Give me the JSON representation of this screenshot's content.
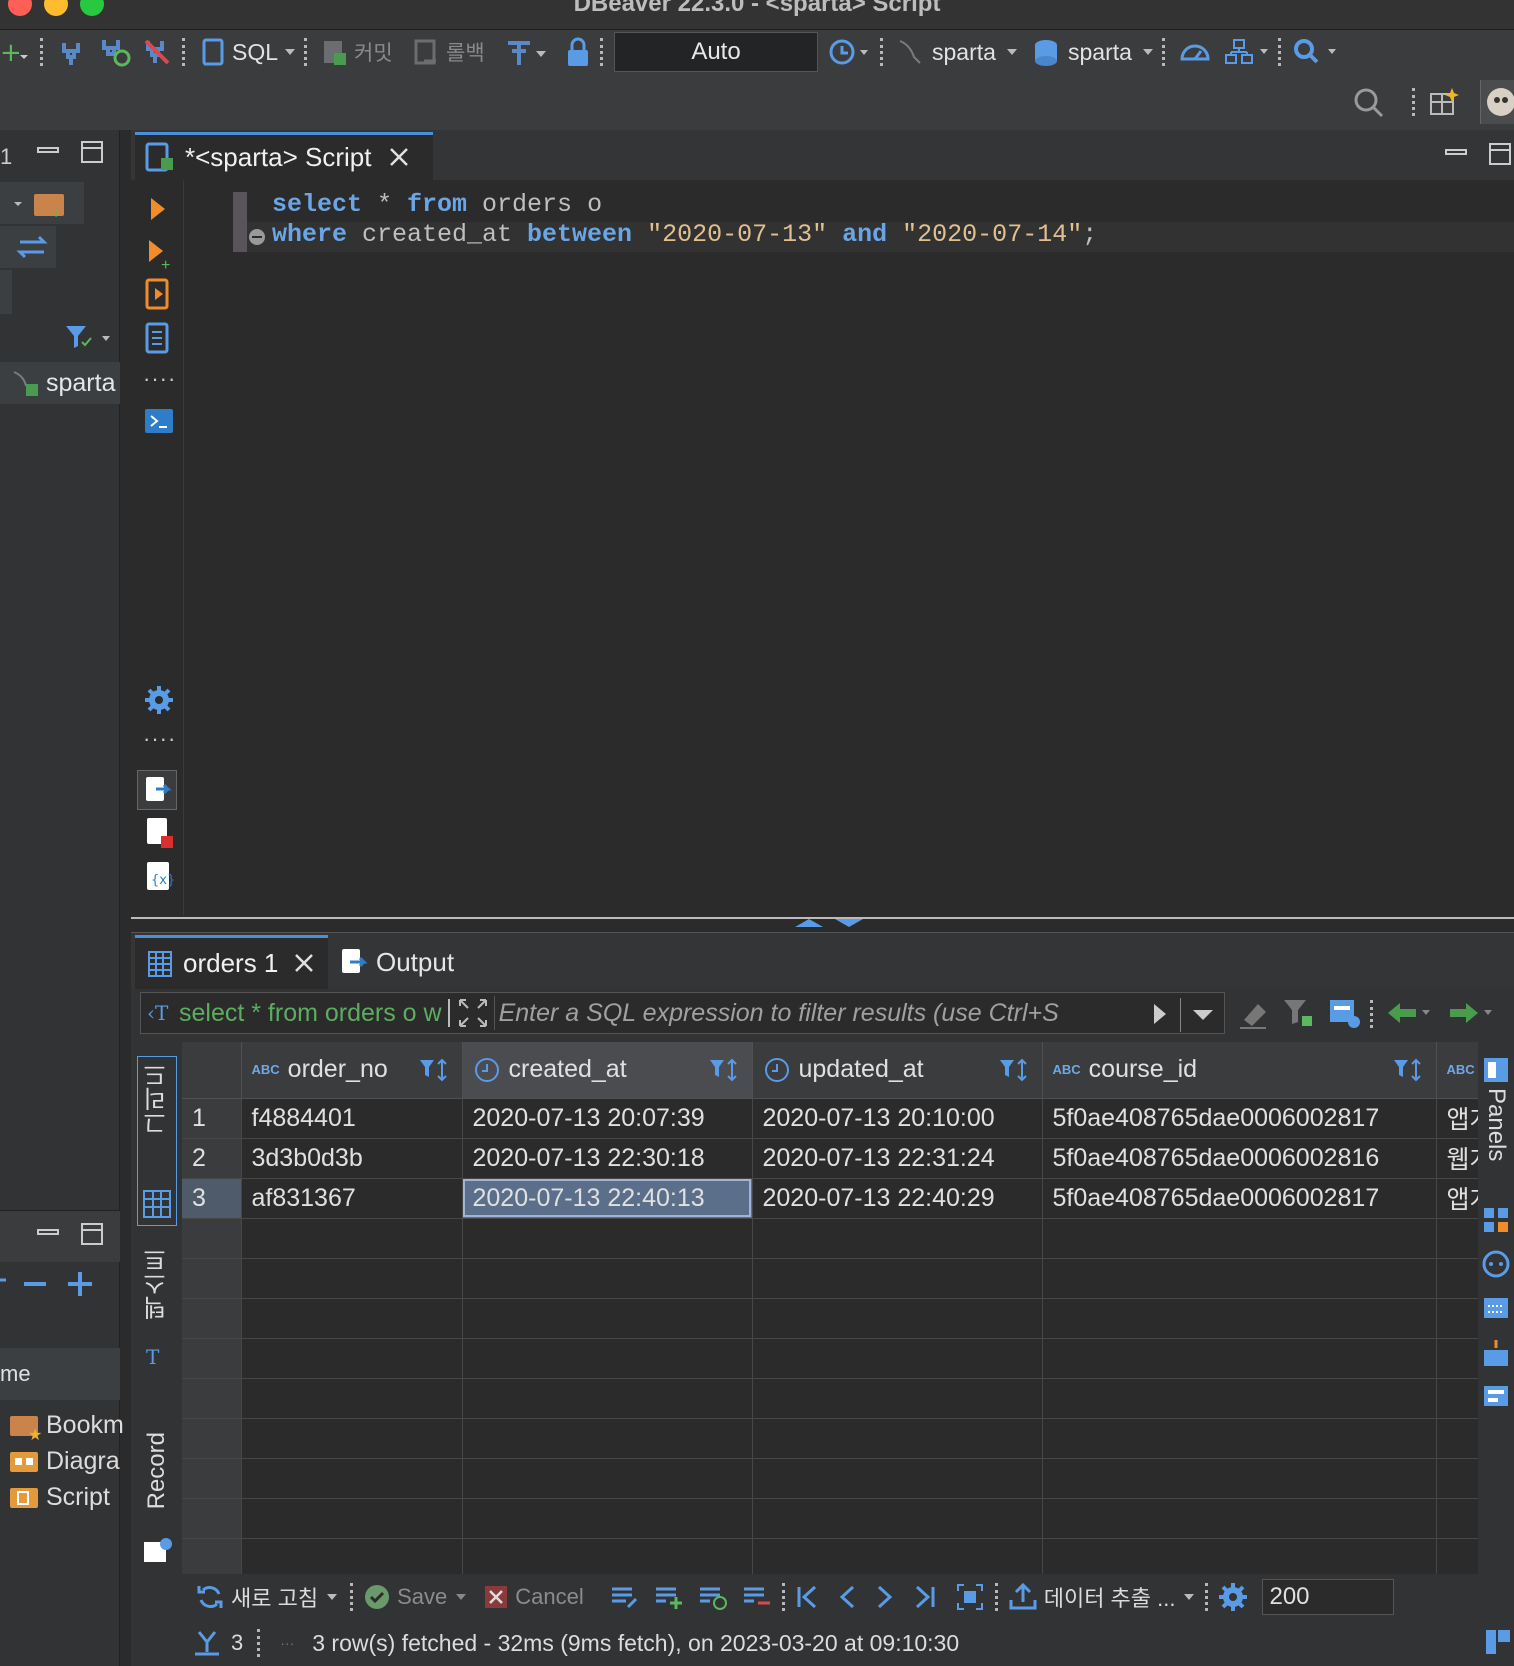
{
  "window": {
    "title": "DBeaver 22.3.0 - <sparta> Script",
    "traffic_colors": [
      "#ff5f57",
      "#febc2e",
      "#28c840"
    ]
  },
  "toolbar": {
    "sql_label": "SQL",
    "commit_label": "커밋",
    "rollback_label": "롤백",
    "transaction_mode": "Auto",
    "datasource_label": "sparta",
    "schema_label": "sparta"
  },
  "navigator": {
    "tree_item": "sparta",
    "projects_header": "me",
    "project_items": [
      "Bookm",
      "Diagra",
      "Script"
    ]
  },
  "editor": {
    "tab_label": "*<sparta> Script",
    "line1": {
      "kw1": "select",
      "t1": " * ",
      "kw2": "from",
      "t2": " orders o"
    },
    "line2": {
      "kw1": "where",
      "t1": " created_at ",
      "kw2": "between",
      "s1": "\"2020-07-13\"",
      "kw3": "and",
      "s2": "\"2020-07-14\"",
      "end": ";"
    }
  },
  "results": {
    "tab_orders": "orders 1",
    "tab_output": "Output",
    "filter_query": "select * from orders o w",
    "filter_placeholder": "Enter a SQL expression to filter results (use Ctrl+S",
    "side_tabs": {
      "grid": "그리드",
      "text": "텍스트",
      "record": "Record"
    },
    "panels_label": "Panels",
    "columns": [
      {
        "name": "order_no",
        "type": "ABC"
      },
      {
        "name": "created_at",
        "type": "clock"
      },
      {
        "name": "updated_at",
        "type": "clock"
      },
      {
        "name": "course_id",
        "type": "ABC"
      },
      {
        "name": "",
        "type": "ABC"
      }
    ],
    "rows": [
      {
        "num": "1",
        "order_no": "f4884401",
        "created_at": "2020-07-13 20:07:39",
        "updated_at": "2020-07-13 20:10:00",
        "course_id": "5f0ae408765dae0006002817",
        "extra": "앱개"
      },
      {
        "num": "2",
        "order_no": "3d3b0d3b",
        "created_at": "2020-07-13 22:30:18",
        "updated_at": "2020-07-13 22:31:24",
        "course_id": "5f0ae408765dae0006002816",
        "extra": "웹개"
      },
      {
        "num": "3",
        "order_no": "af831367",
        "created_at": "2020-07-13 22:40:13",
        "updated_at": "2020-07-13 22:40:29",
        "course_id": "5f0ae408765dae0006002817",
        "extra": "앱개"
      }
    ]
  },
  "bottom": {
    "refresh_label": "새로 고침",
    "save_label": "Save",
    "cancel_label": "Cancel",
    "export_label": "데이터 추출 ...",
    "fetch_size": "200",
    "row_count": "3",
    "status": "3 row(s) fetched - 32ms (9ms fetch), on 2023-03-20 at 09:10:30"
  }
}
